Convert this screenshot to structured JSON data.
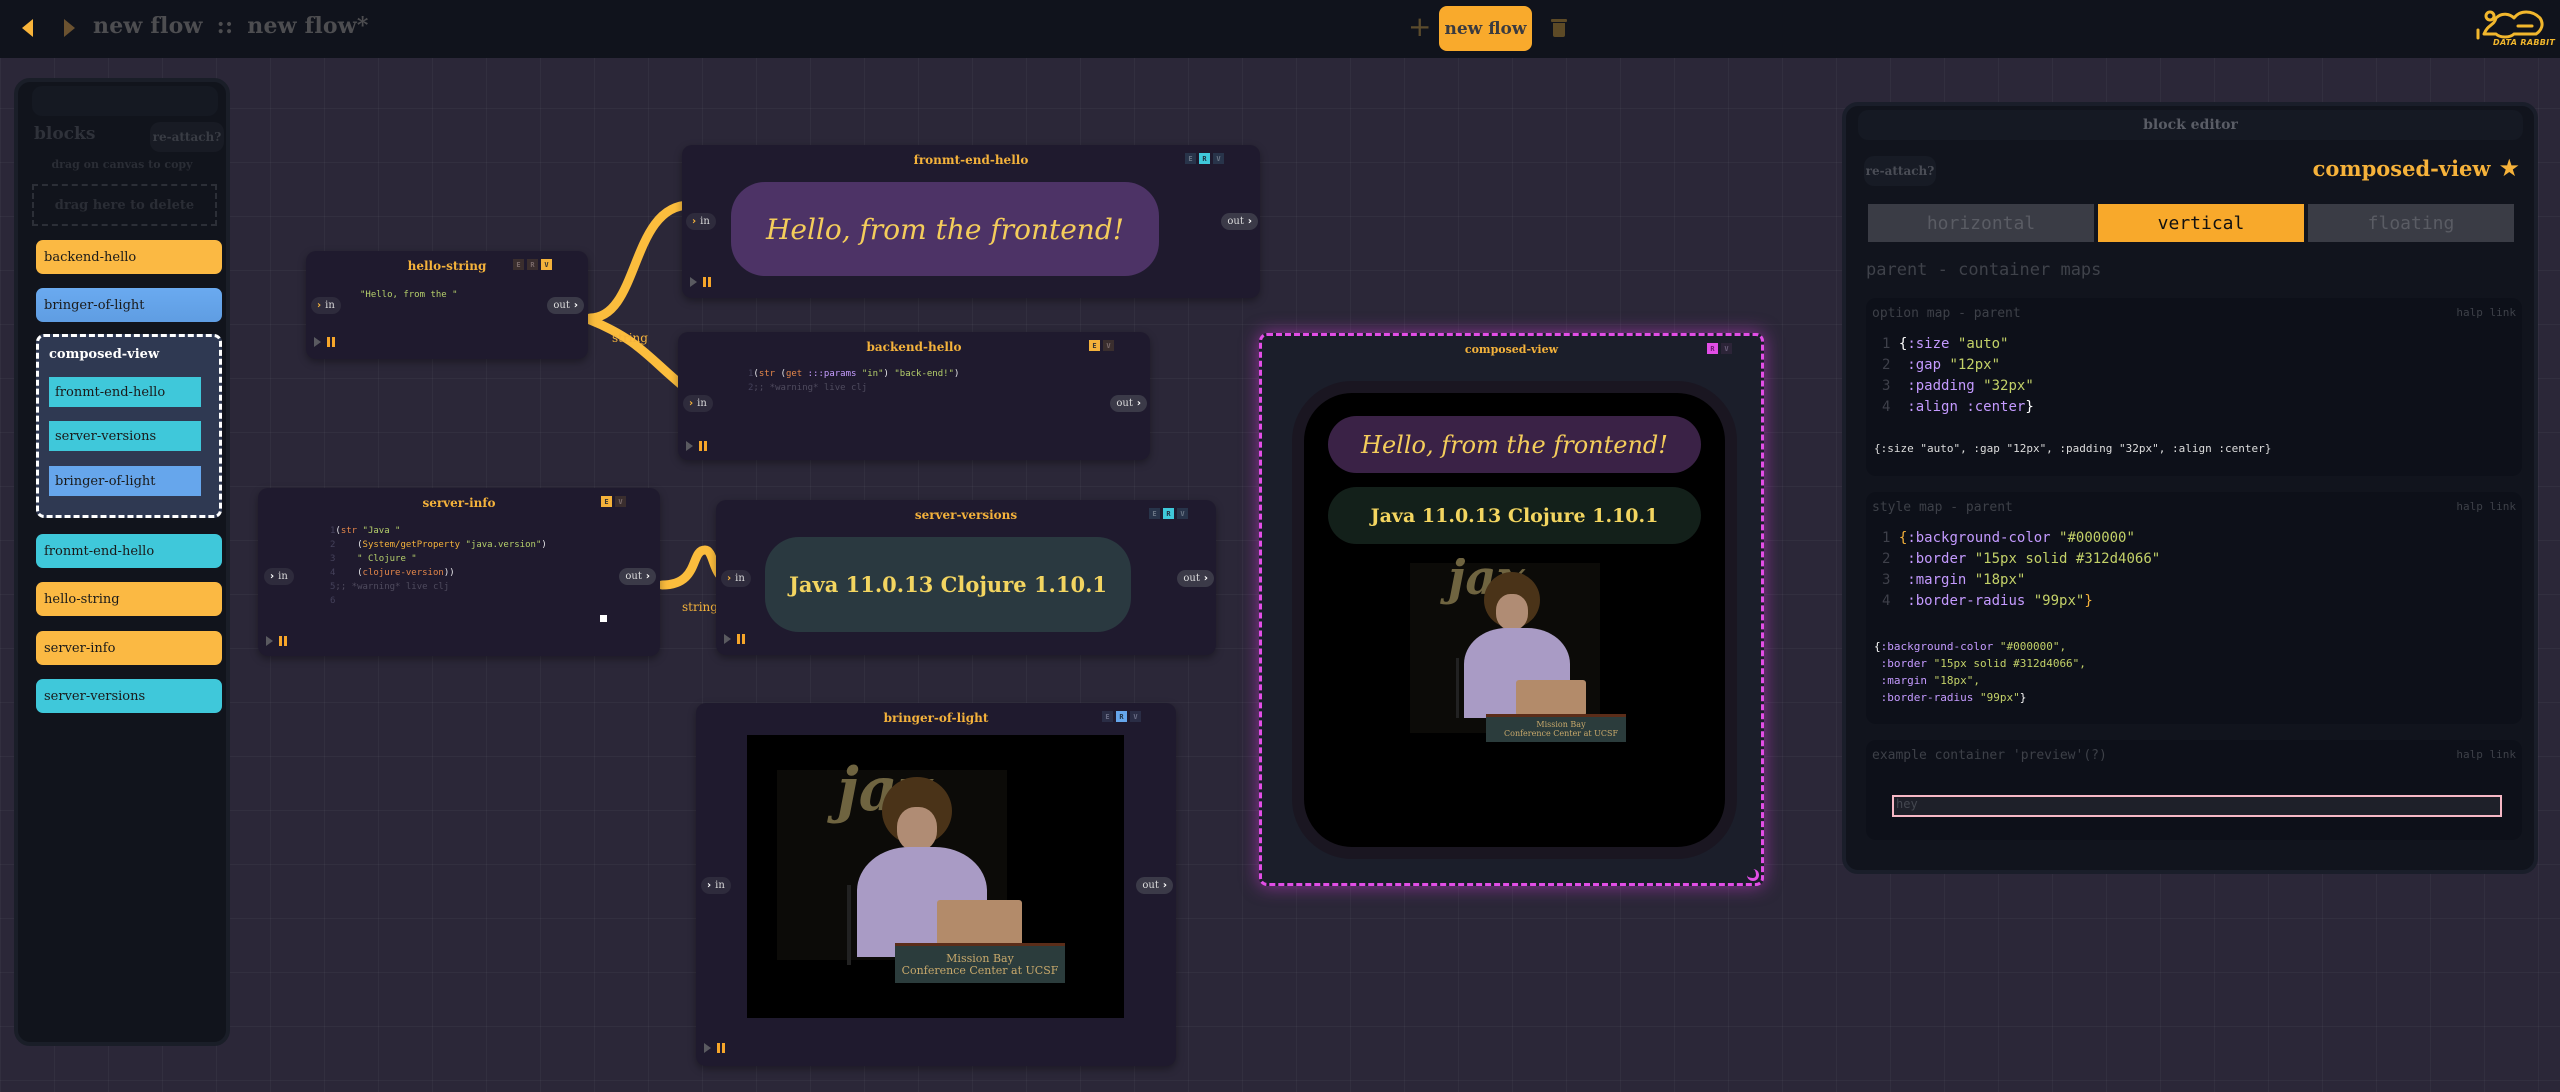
{
  "topbar": {
    "flow_name": "new flow",
    "separator": "::",
    "flow_file": "new flow*",
    "new_flow_label": "new flow",
    "logo_text": "DATA RABBIT"
  },
  "sidebar": {
    "title": "blocks",
    "reattach_label": "re-attach?",
    "hint": "drag on canvas to copy",
    "delete_zone": "drag here to delete",
    "items": [
      {
        "label": "backend-hello",
        "color": "#fbb943"
      },
      {
        "label": "bringer-of-light",
        "color": "#66a6ec"
      },
      {
        "label": "fronmt-end-hello",
        "color": "#3fc8da"
      },
      {
        "label": "hello-string",
        "color": "#fbb943"
      },
      {
        "label": "server-info",
        "color": "#fbb943"
      },
      {
        "label": "server-versions",
        "color": "#3fc8da"
      }
    ],
    "group": {
      "label": "composed-view",
      "children": [
        {
          "label": "fronmt-end-hello",
          "color": "#3fc8da"
        },
        {
          "label": "server-versions",
          "color": "#3fc8da"
        },
        {
          "label": "bringer-of-light",
          "color": "#66a6ec"
        }
      ]
    }
  },
  "blocks": {
    "hello_string": {
      "title": "hello-string",
      "flags": [
        "E",
        "R",
        "V"
      ],
      "code": "\"Hello, from the \"",
      "in": "in",
      "out": "out"
    },
    "front_end_hello": {
      "title": "fronmt-end-hello",
      "flags": [
        "E",
        "R",
        "V"
      ],
      "render": "Hello, from the frontend!",
      "in": "in",
      "out": "out"
    },
    "backend_hello": {
      "title": "backend-hello",
      "flags": [
        "E",
        "V"
      ],
      "code_lines": [
        {
          "n": "1",
          "fn": "str",
          "fn2": "get",
          "kw": ":::params",
          "s1": "\"in\"",
          "s2": "\"back-end!\""
        },
        {
          "n": "2",
          "comment": ";; *warning* live clj"
        }
      ],
      "in": "in",
      "out": "out"
    },
    "server_info": {
      "title": "server-info",
      "flags": [
        "E",
        "V"
      ],
      "lines": {
        "l1_n": "1",
        "l1_fn": "str",
        "l1_s": "\"Java \"",
        "l2_n": "2",
        "l2_fn": "System/getProperty",
        "l2_s": "\"java.version\"",
        "l3_n": "3",
        "l3_s": "\" Clojure \"",
        "l4_n": "4",
        "l4_fn": "clojure-version",
        "l5_n": "5",
        "l5_c": ";; *warning* live clj",
        "l6_n": "6"
      },
      "in": "in",
      "out": "out"
    },
    "server_versions": {
      "title": "server-versions",
      "flags": [
        "E",
        "R",
        "V"
      ],
      "render": "Java 11.0.13 Clojure 1.10.1",
      "in": "in",
      "out": "out"
    },
    "bringer_of_light": {
      "title": "bringer-of-light",
      "flags": [
        "E",
        "R",
        "V"
      ],
      "photo_sign": "jax",
      "podium_line1": "Mission Bay",
      "podium_line2": "Conference Center at UCSF",
      "in": "in",
      "out": "out"
    },
    "composed_view": {
      "title": "composed-view",
      "flags": [
        "R",
        "V"
      ],
      "hello": "Hello, from the frontend!",
      "versions": "Java 11.0.13 Clojure 1.10.1"
    }
  },
  "wires": {
    "label_1": "string",
    "label_2": "string"
  },
  "editor": {
    "header": "block editor",
    "reattach_label": "re-attach?",
    "block_name": "composed-view",
    "tabs": [
      {
        "label": "horizontal",
        "active": false
      },
      {
        "label": "vertical",
        "active": true
      },
      {
        "label": "floating",
        "active": false
      }
    ],
    "section_title": "parent - container maps",
    "option_map": {
      "title": "option map - parent",
      "halp": "halp link",
      "lines": [
        {
          "n": "1",
          "k": ":size",
          "v": "\"auto\""
        },
        {
          "n": "2",
          "k": ":gap",
          "v": "\"12px\""
        },
        {
          "n": "3",
          "k": ":padding",
          "v": "\"32px\""
        },
        {
          "n": "4",
          "k": ":align",
          "v": ":center"
        }
      ],
      "result": "{:size \"auto\", :gap \"12px\", :padding \"32px\", :align :center}"
    },
    "style_map": {
      "title": "style map - parent",
      "halp": "halp link",
      "lines": [
        {
          "n": "1",
          "k": ":background-color",
          "v": "\"#000000\""
        },
        {
          "n": "2",
          "k": ":border",
          "v": "\"15px solid #312d4066\""
        },
        {
          "n": "3",
          "k": ":margin",
          "v": "\"18px\""
        },
        {
          "n": "4",
          "k": ":border-radius",
          "v": "\"99px\""
        }
      ],
      "result_lines": [
        {
          "k": ":background-color",
          "v": "\"#000000\","
        },
        {
          "k": ":border",
          "v": "\"15px solid #312d4066\","
        },
        {
          "k": ":margin",
          "v": "\"18px\","
        },
        {
          "k": ":border-radius",
          "v": "\"99px\""
        }
      ]
    },
    "preview": {
      "title": "example container 'preview'(?)",
      "halp": "halp link",
      "input_value": "hey"
    }
  },
  "colors": {
    "accent": "#f8a92b",
    "selection": "#e24ee6",
    "cyan": "#3fc8da",
    "blue": "#66a6ec"
  }
}
